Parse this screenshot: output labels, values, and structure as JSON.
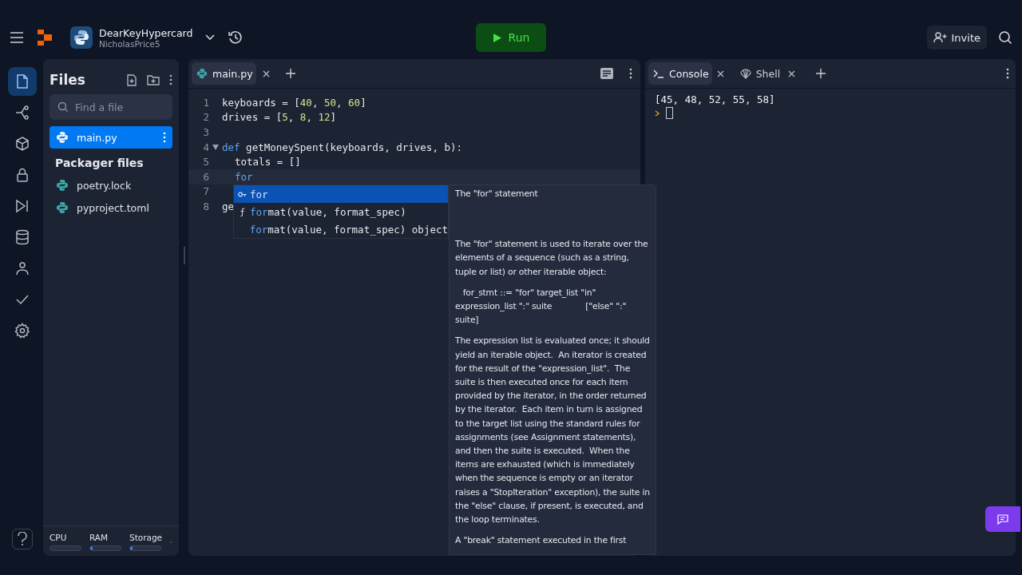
{
  "header": {
    "repl_name": "DearKeyHypercard",
    "owner": "NicholasPrice5",
    "run_label": "Run",
    "invite_label": "Invite"
  },
  "activity_bar": [
    {
      "selected": true
    },
    {
      "selected": false
    },
    {
      "selected": false
    },
    {
      "selected": false
    },
    {
      "selected": false
    },
    {
      "selected": false
    },
    {
      "selected": false
    },
    {
      "selected": false
    },
    {
      "selected": false
    }
  ],
  "files": {
    "title": "Files",
    "search_placeholder": "Find a file",
    "items": [
      {
        "name": "main.py",
        "selected": true
      }
    ],
    "packager_title": "Packager files",
    "packager_items": [
      {
        "name": "poetry.lock"
      },
      {
        "name": "pyproject.toml"
      }
    ]
  },
  "resources": [
    {
      "label": "CPU"
    },
    {
      "label": "RAM",
      "level": 0.08
    },
    {
      "label": "Storage",
      "level": 0.08
    }
  ],
  "editor": {
    "tabs": [
      {
        "label": "main.py",
        "selected": true
      }
    ],
    "lines": [
      {
        "number": "1",
        "tokens": [
          {
            "kind": "plain",
            "text": "keyboards = ["
          },
          {
            "kind": "num",
            "text": "40"
          },
          {
            "kind": "plain",
            "text": ", "
          },
          {
            "kind": "num",
            "text": "50"
          },
          {
            "kind": "plain",
            "text": ", "
          },
          {
            "kind": "num",
            "text": "60"
          },
          {
            "kind": "plain",
            "text": "]"
          }
        ]
      },
      {
        "number": "2",
        "tokens": [
          {
            "kind": "plain",
            "text": "drives = ["
          },
          {
            "kind": "num",
            "text": "5"
          },
          {
            "kind": "plain",
            "text": ", "
          },
          {
            "kind": "num",
            "text": "8"
          },
          {
            "kind": "plain",
            "text": ", "
          },
          {
            "kind": "num",
            "text": "12"
          },
          {
            "kind": "plain",
            "text": "]"
          }
        ]
      },
      {
        "number": "3"
      },
      {
        "number": "4",
        "expanded": true,
        "tokens": [
          {
            "kind": "kw",
            "text": "def"
          },
          {
            "kind": "plain",
            "text": " getMoneySpent(keyboards, drives, b):"
          }
        ]
      },
      {
        "number": "5",
        "indented": true,
        "tokens": [
          {
            "kind": "plain",
            "text": "totals = []"
          }
        ]
      },
      {
        "number": "6",
        "indented": true,
        "current": true,
        "tokens": [
          {
            "kind": "kw",
            "text": "for"
          }
        ]
      },
      {
        "number": "7"
      },
      {
        "number": "8",
        "tokens": [
          {
            "kind": "plain",
            "text": "ge"
          }
        ]
      }
    ],
    "suggestions": [
      {
        "kind": "keyword",
        "match": "for",
        "selected": true
      },
      {
        "kind": "function",
        "match": "for",
        "rest": "mat(value, format_spec)",
        "selected": false
      },
      {
        "kind": "none",
        "match": "for",
        "rest": "mat(value, format_spec) object",
        "selected": false
      }
    ],
    "doc": {
      "title": "The \"for\" statement",
      "paragraphs": [
        {
          "text": "The \"for\" statement is used to iterate over the elements of a sequence (such as a string, tuple or list) or other iterable object:"
        },
        {
          "text": "   for_stmt ::= \"for\" target_list \"in\" expression_list \":\" suite             [\"else\" \":\" suite]"
        },
        {
          "text": "The expression list is evaluated once; it should yield an iterable object.  An iterator is created for the result of the \"expression_list\".  The suite is then executed once for each item provided by the iterator, in the order returned by the iterator.  Each item in turn is assigned to the target list using the standard rules for assignments (see Assignment statements), and then the suite is executed.  When the items are exhausted (which is immediately when the sequence is empty or an iterator raises a \"StopIteration\" exception), the suite in the \"else\" clause, if present, is executed, and the loop terminates."
        },
        {
          "text": "A \"break\" statement executed in the first"
        }
      ]
    }
  },
  "console": {
    "tabs": [
      {
        "label": "Console",
        "selected": true
      },
      {
        "label": "Shell",
        "selected": false
      }
    ],
    "output": "[45, 48, 52, 55, 58]"
  }
}
